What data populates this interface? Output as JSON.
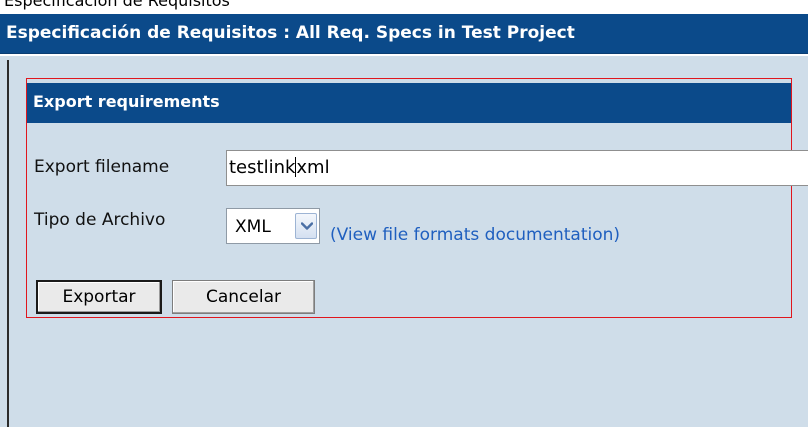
{
  "top_strip": {
    "text": "Especificación de Requisitos"
  },
  "page": {
    "title": "Especificación de Requisitos : All Req. Specs in Test Project"
  },
  "panel": {
    "header": "Export requirements",
    "filename_label": "Export filename",
    "filename_value_before": "testlink",
    "filename_value_after": "xml",
    "filetype_label": "Tipo de Archivo",
    "filetype_selected": "XML",
    "doc_link": "(View file formats documentation)",
    "export_button": "Exportar",
    "cancel_button": "Cancelar"
  },
  "colors": {
    "header_bg": "#0b4a8a",
    "content_bg": "#cfdde9",
    "panel_border": "#e0161d",
    "link": "#1f5fbf"
  },
  "icons": {
    "select_arrow": "chevron-down-icon"
  }
}
